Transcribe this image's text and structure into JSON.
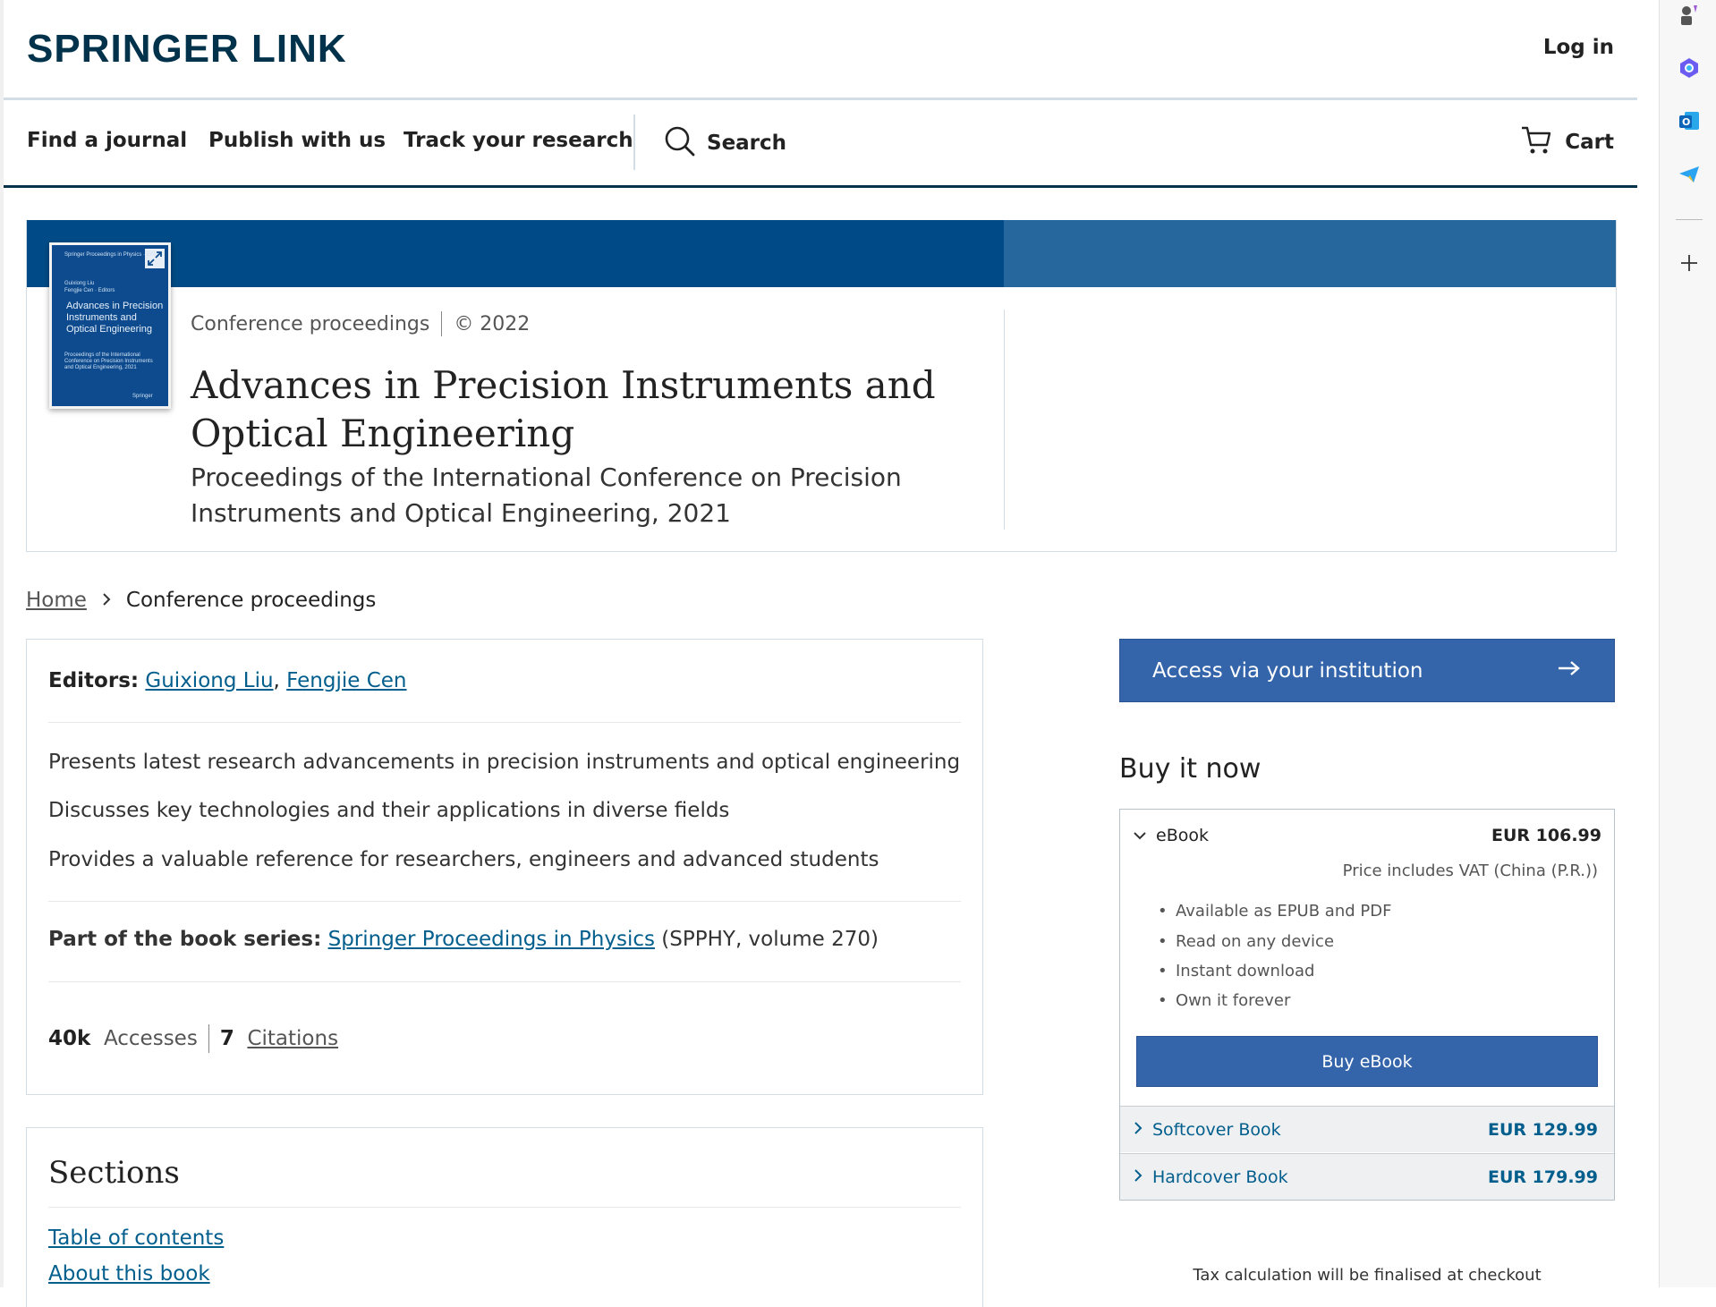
{
  "header": {
    "logo": "Springer Link",
    "login": "Log in"
  },
  "nav": {
    "find_journal": "Find a journal",
    "publish": "Publish with us",
    "track": "Track your research",
    "search": "Search",
    "cart": "Cart"
  },
  "hero": {
    "type": "Conference proceedings",
    "year": "© 2022",
    "title": "Advances in Precision Instruments and Optical Engineering",
    "subtitle": "Proceedings of the International Conference on Precision Instruments and Optical Engineering, 2021",
    "cover": {
      "series_line": "Springer Proceedings in Physics · 270",
      "editors_line1": "Guixiong Liu",
      "editors_line2": "Fengjie Cen · Editors",
      "title": "Advances in Precision Instruments and Optical Engineering",
      "desc": "Proceedings of the International Conference on Precision Instruments and Optical Engineering, 2021",
      "publisher": "Springer"
    }
  },
  "breadcrumb": {
    "home": "Home",
    "current": "Conference proceedings"
  },
  "details": {
    "editors_label": "Editors:",
    "editor1": "Guixiong Liu",
    "editor_sep": ",",
    "editor2": "Fengjie Cen",
    "bullets": [
      "Presents latest research advancements in precision instruments and optical engineering",
      "Discusses key technologies and their applications in diverse fields",
      "Provides a valuable reference for researchers, engineers and advanced students"
    ],
    "series_label": "Part of the book series:",
    "series_link": "Springer Proceedings in Physics",
    "series_suffix": "(SPPHY, volume 270)",
    "accesses_count": "40k",
    "accesses_label": "Accesses",
    "citations_count": "7",
    "citations_label": "Citations"
  },
  "sections": {
    "title": "Sections",
    "toc": "Table of contents",
    "about": "About this book"
  },
  "buy": {
    "access_button": "Access via your institution",
    "title": "Buy it now",
    "ebook_label": "eBook",
    "ebook_price": "EUR 106.99",
    "vat": "Price includes VAT (China (P.R.))",
    "features": [
      "Available as EPUB and PDF",
      "Read on any device",
      "Instant download",
      "Own it forever"
    ],
    "buy_button": "Buy eBook",
    "softcover_label": "Softcover Book",
    "softcover_price": "EUR 129.99",
    "hardcover_label": "Hardcover Book",
    "hardcover_price": "EUR 179.99",
    "tax_note": "Tax calculation will be finalised at checkout"
  },
  "colors": {
    "brand_dark": "#01324b",
    "hero_band": "#004b87",
    "hero_band_light": "#26679e",
    "button_blue": "#3465aa",
    "link_blue": "#025e8d"
  },
  "icons": {
    "search": "search-icon",
    "cart": "cart-icon",
    "breadcrumb": "chevron-right-icon",
    "access": "arrow-right-icon",
    "ebook_toggle": "chevron-down-icon",
    "option_toggle": "chevron-right-icon",
    "cover_expand": "expand-icon",
    "sidebar": [
      "extension-chess-icon",
      "copilot-icon",
      "outlook-icon",
      "telegram-icon",
      "add-icon"
    ]
  }
}
